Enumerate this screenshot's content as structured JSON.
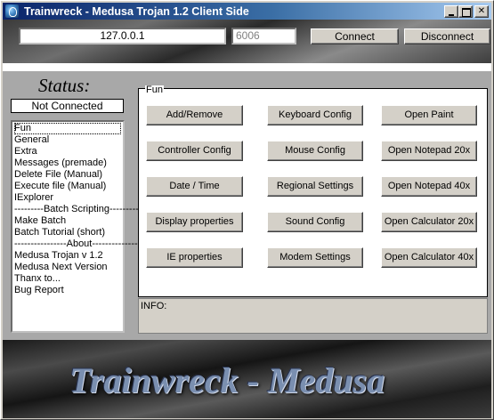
{
  "window": {
    "title": "Trainwreck - Medusa Trojan 1.2 Client Side"
  },
  "connection": {
    "ip_value": "127.0.0.1",
    "port_value": "6006",
    "connect_label": "Connect",
    "disconnect_label": "Disconnect"
  },
  "status": {
    "heading": "Status:",
    "value": "Not Connected"
  },
  "menu": {
    "items": [
      "Fun",
      "General",
      "Extra",
      "Messages (premade)",
      "Delete File (Manual)",
      "Execute file (Manual)",
      "IExplorer",
      "---------Batch Scripting---------",
      "Make Batch",
      "Batch Tutorial (short)",
      "----------------About----------------",
      "Medusa Trojan v 1.2",
      "Medusa Next Version",
      "Thanx to...",
      "Bug Report"
    ],
    "selected": "Fun"
  },
  "fun_group": {
    "legend": "Fun",
    "buttons": [
      "Add/Remove",
      "Keyboard Config",
      "Open Paint",
      "Controller Config",
      "Mouse Config",
      "Open Notepad 20x",
      "Date / Time",
      "Regional Settings",
      "Open Notepad 40x",
      "Display properties",
      "Sound Config",
      "Open Calculator 20x",
      "IE properties",
      "Modem Settings",
      "Open Calculator 40x"
    ]
  },
  "info": {
    "label": "INFO:"
  },
  "banner": {
    "text": "Trainwreck - Medusa"
  }
}
